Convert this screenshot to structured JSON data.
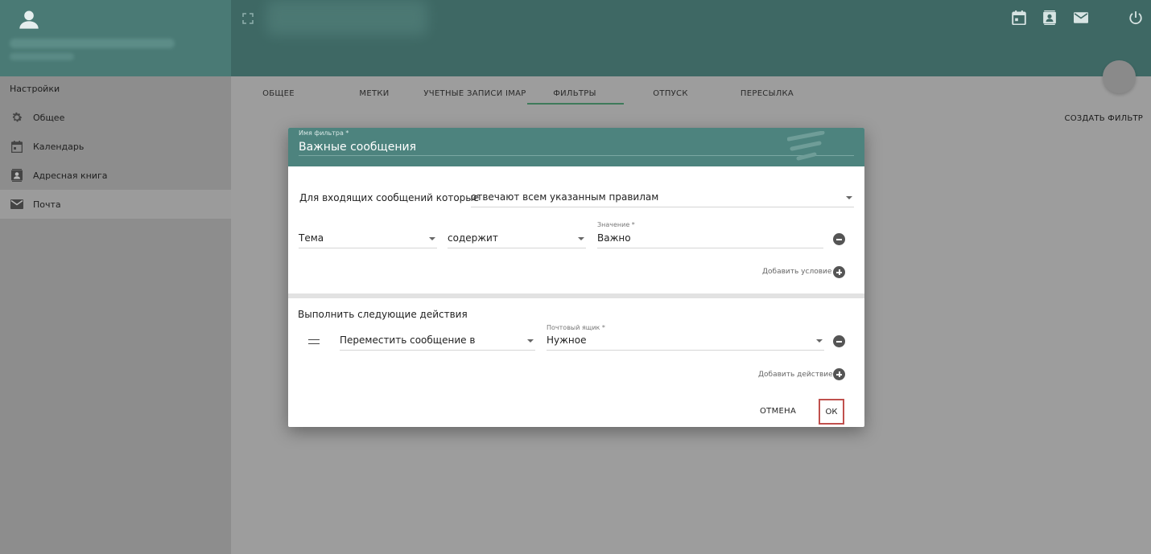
{
  "sidebar": {
    "title": "Настройки",
    "items": [
      {
        "label": "Общее",
        "icon": "gear-icon"
      },
      {
        "label": "Календарь",
        "icon": "calendar-icon"
      },
      {
        "label": "Адресная книга",
        "icon": "contacts-icon"
      },
      {
        "label": "Почта",
        "icon": "mail-icon",
        "active": true
      }
    ]
  },
  "topbar": {
    "icons": [
      "calendar-icon",
      "contacts-icon",
      "mail-icon",
      "power-icon"
    ]
  },
  "tabs": [
    {
      "label": "ОБЩЕЕ"
    },
    {
      "label": "МЕТКИ"
    },
    {
      "label": "УЧЕТНЫЕ ЗАПИСИ IMAP"
    },
    {
      "label": "ФИЛЬТРЫ",
      "active": true
    },
    {
      "label": "ОТПУСК"
    },
    {
      "label": "ПЕРЕСЫЛКА"
    }
  ],
  "create_filter_label": "СОЗДАТЬ ФИЛЬТР",
  "dialog": {
    "filter_name_label": "Имя фильтра *",
    "filter_name_value": "Важные сообщения",
    "incoming_label": "Для входящих сообщений которые",
    "match_mode": "отвечают всем указанным правилам",
    "condition": {
      "field": "Тема",
      "operator": "содержит",
      "value_label": "Значение *",
      "value": "Важно"
    },
    "add_condition_label": "Добавить условие",
    "actions_title": "Выполнить следующие действия",
    "action": {
      "type": "Переместить сообщение в",
      "mailbox_label": "Почтовый ящик *",
      "mailbox": "Нужное"
    },
    "add_action_label": "Добавить действие",
    "cancel_label": "ОТМЕНА",
    "ok_label": "ОК"
  },
  "colors": {
    "header_teal": "#4d837e",
    "topbar": "#3e6864",
    "highlight": "#c0504d"
  }
}
